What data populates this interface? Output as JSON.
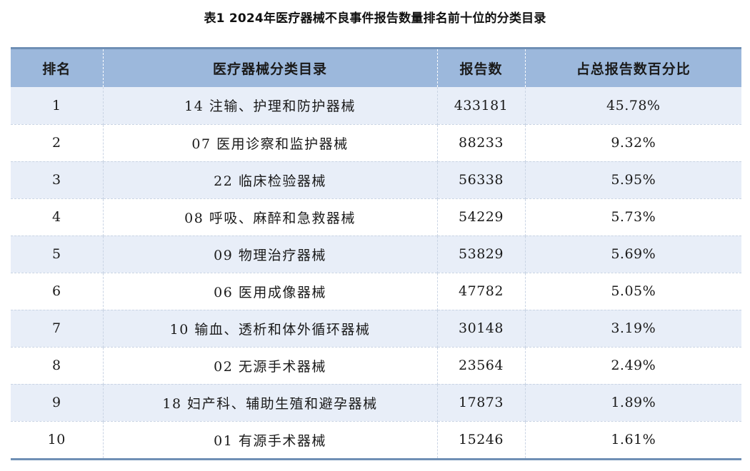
{
  "caption": "表1  2024年医疗器械不良事件报告数量排名前十位的分类目录",
  "table": {
    "headers": [
      "排名",
      "医疗器械分类目录",
      "报告数",
      "占总报告数百分比"
    ],
    "rows": [
      {
        "rank": "1",
        "category": "14 注输、护理和防护器械",
        "count": "433181",
        "percent": "45.78%"
      },
      {
        "rank": "2",
        "category": "07 医用诊察和监护器械",
        "count": "88233",
        "percent": "9.32%"
      },
      {
        "rank": "3",
        "category": "22 临床检验器械",
        "count": "56338",
        "percent": "5.95%"
      },
      {
        "rank": "4",
        "category": "08 呼吸、麻醉和急救器械",
        "count": "54229",
        "percent": "5.73%"
      },
      {
        "rank": "5",
        "category": "09 物理治疗器械",
        "count": "53829",
        "percent": "5.69%"
      },
      {
        "rank": "6",
        "category": "06 医用成像器械",
        "count": "47782",
        "percent": "5.05%"
      },
      {
        "rank": "7",
        "category": "10 输血、透析和体外循环器械",
        "count": "30148",
        "percent": "3.19%"
      },
      {
        "rank": "8",
        "category": "02 无源手术器械",
        "count": "23564",
        "percent": "2.49%"
      },
      {
        "rank": "9",
        "category": "18 妇产科、辅助生殖和避孕器械",
        "count": "17873",
        "percent": "1.89%"
      },
      {
        "rank": "10",
        "category": "01 有源手术器械",
        "count": "15246",
        "percent": "1.61%"
      }
    ]
  },
  "colors": {
    "header_bg": "#9cb8dc",
    "band_bg": "#e8eef8",
    "rule": "#6f8fb5"
  }
}
